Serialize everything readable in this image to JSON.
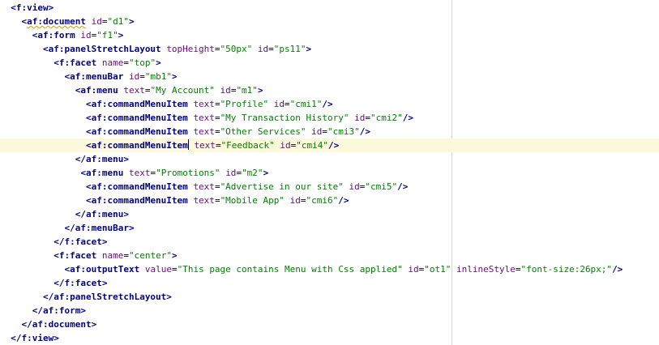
{
  "editor": {
    "language": "jspx",
    "current_line": 10,
    "lines": [
      {
        "indent": "  ",
        "segments": [
          [
            "tag",
            "<f:view>"
          ]
        ]
      },
      {
        "indent": "    ",
        "segments": [
          [
            "tag",
            "<af:document"
          ],
          [
            "plain",
            " "
          ],
          [
            "attr",
            "id"
          ],
          [
            "plain",
            "="
          ],
          [
            "val",
            "\"d1\""
          ],
          [
            "tag",
            ">"
          ]
        ],
        "squiggle_on": "af:document"
      },
      {
        "indent": "      ",
        "segments": [
          [
            "tag",
            "<af:form"
          ],
          [
            "plain",
            " "
          ],
          [
            "attr",
            "id"
          ],
          [
            "plain",
            "="
          ],
          [
            "val",
            "\"f1\""
          ],
          [
            "tag",
            ">"
          ]
        ]
      },
      {
        "indent": "        ",
        "segments": [
          [
            "tag",
            "<af:panelStretchLayout"
          ],
          [
            "plain",
            " "
          ],
          [
            "attr",
            "topHeight"
          ],
          [
            "plain",
            "="
          ],
          [
            "val",
            "\"50px\""
          ],
          [
            "plain",
            " "
          ],
          [
            "attr",
            "id"
          ],
          [
            "plain",
            "="
          ],
          [
            "val",
            "\"ps11\""
          ],
          [
            "tag",
            ">"
          ]
        ]
      },
      {
        "indent": "          ",
        "segments": [
          [
            "tag",
            "<f:facet"
          ],
          [
            "plain",
            " "
          ],
          [
            "attr",
            "name"
          ],
          [
            "plain",
            "="
          ],
          [
            "val",
            "\"top\""
          ],
          [
            "tag",
            ">"
          ]
        ]
      },
      {
        "indent": "            ",
        "segments": [
          [
            "tag",
            "<af:menuBar"
          ],
          [
            "plain",
            " "
          ],
          [
            "attr",
            "id"
          ],
          [
            "plain",
            "="
          ],
          [
            "val",
            "\"mb1\""
          ],
          [
            "tag",
            ">"
          ]
        ]
      },
      {
        "indent": "              ",
        "segments": [
          [
            "tag",
            "<af:menu"
          ],
          [
            "plain",
            " "
          ],
          [
            "attr",
            "text"
          ],
          [
            "plain",
            "="
          ],
          [
            "val",
            "\"My Account\""
          ],
          [
            "plain",
            " "
          ],
          [
            "attr",
            "id"
          ],
          [
            "plain",
            "="
          ],
          [
            "val",
            "\"m1\""
          ],
          [
            "tag",
            ">"
          ]
        ]
      },
      {
        "indent": "                ",
        "segments": [
          [
            "tag",
            "<af:commandMenuItem"
          ],
          [
            "plain",
            " "
          ],
          [
            "attr",
            "text"
          ],
          [
            "plain",
            "="
          ],
          [
            "val",
            "\"Profile\""
          ],
          [
            "plain",
            " "
          ],
          [
            "attr",
            "id"
          ],
          [
            "plain",
            "="
          ],
          [
            "val",
            "\"cmi1\""
          ],
          [
            "tag",
            "/>"
          ]
        ]
      },
      {
        "indent": "                ",
        "segments": [
          [
            "tag",
            "<af:commandMenuItem"
          ],
          [
            "plain",
            " "
          ],
          [
            "attr",
            "text"
          ],
          [
            "plain",
            "="
          ],
          [
            "val",
            "\"My Transaction History\""
          ],
          [
            "plain",
            " "
          ],
          [
            "attr",
            "id"
          ],
          [
            "plain",
            "="
          ],
          [
            "val",
            "\"cmi2\""
          ],
          [
            "tag",
            "/>"
          ]
        ]
      },
      {
        "indent": "                ",
        "segments": [
          [
            "tag",
            "<af:commandMenuItem"
          ],
          [
            "plain",
            " "
          ],
          [
            "attr",
            "text"
          ],
          [
            "plain",
            "="
          ],
          [
            "val",
            "\"Other Services\""
          ],
          [
            "plain",
            " "
          ],
          [
            "attr",
            "id"
          ],
          [
            "plain",
            "="
          ],
          [
            "val",
            "\"cmi3\""
          ],
          [
            "tag",
            "/>"
          ]
        ]
      },
      {
        "indent": "                ",
        "segments": [
          [
            "tag",
            "<af:commandMenuItem"
          ],
          [
            "caret",
            ""
          ],
          [
            "plain",
            " "
          ],
          [
            "attr",
            "text"
          ],
          [
            "plain",
            "="
          ],
          [
            "val",
            "\"Feedback\""
          ],
          [
            "plain",
            " "
          ],
          [
            "attr",
            "id"
          ],
          [
            "plain",
            "="
          ],
          [
            "val",
            "\"cmi4\""
          ],
          [
            "tag",
            "/>"
          ]
        ]
      },
      {
        "indent": "              ",
        "segments": [
          [
            "tag",
            "</af:menu>"
          ]
        ]
      },
      {
        "indent": "               ",
        "segments": [
          [
            "tag",
            "<af:menu"
          ],
          [
            "plain",
            " "
          ],
          [
            "attr",
            "text"
          ],
          [
            "plain",
            "="
          ],
          [
            "val",
            "\"Promotions\""
          ],
          [
            "plain",
            " "
          ],
          [
            "attr",
            "id"
          ],
          [
            "plain",
            "="
          ],
          [
            "val",
            "\"m2\""
          ],
          [
            "tag",
            ">"
          ]
        ]
      },
      {
        "indent": "                ",
        "segments": [
          [
            "tag",
            "<af:commandMenuItem"
          ],
          [
            "plain",
            " "
          ],
          [
            "attr",
            "text"
          ],
          [
            "plain",
            "="
          ],
          [
            "val",
            "\"Advertise in our site\""
          ],
          [
            "plain",
            " "
          ],
          [
            "attr",
            "id"
          ],
          [
            "plain",
            "="
          ],
          [
            "val",
            "\"cmi5\""
          ],
          [
            "tag",
            "/>"
          ]
        ]
      },
      {
        "indent": "                ",
        "segments": [
          [
            "tag",
            "<af:commandMenuItem"
          ],
          [
            "plain",
            " "
          ],
          [
            "attr",
            "text"
          ],
          [
            "plain",
            "="
          ],
          [
            "val",
            "\"Mobile App\""
          ],
          [
            "plain",
            " "
          ],
          [
            "attr",
            "id"
          ],
          [
            "plain",
            "="
          ],
          [
            "val",
            "\"cmi6\""
          ],
          [
            "tag",
            "/>"
          ]
        ]
      },
      {
        "indent": "              ",
        "segments": [
          [
            "tag",
            "</af:menu>"
          ]
        ]
      },
      {
        "indent": "            ",
        "segments": [
          [
            "tag",
            "</af:menuBar>"
          ]
        ]
      },
      {
        "indent": "          ",
        "segments": [
          [
            "tag",
            "</f:facet>"
          ]
        ]
      },
      {
        "indent": "          ",
        "segments": [
          [
            "tag",
            "<f:facet"
          ],
          [
            "plain",
            " "
          ],
          [
            "attr",
            "name"
          ],
          [
            "plain",
            "="
          ],
          [
            "val",
            "\"center\""
          ],
          [
            "tag",
            ">"
          ]
        ]
      },
      {
        "indent": "            ",
        "segments": [
          [
            "tag",
            "<af:outputText"
          ],
          [
            "plain",
            " "
          ],
          [
            "attr",
            "value"
          ],
          [
            "plain",
            "="
          ],
          [
            "val",
            "\"This page contains Menu with Css applied\""
          ],
          [
            "plain",
            " "
          ],
          [
            "attr",
            "id"
          ],
          [
            "plain",
            "="
          ],
          [
            "val",
            "\"ot1\""
          ],
          [
            "plain",
            " "
          ],
          [
            "attr",
            "inlineStyle"
          ],
          [
            "plain",
            "="
          ],
          [
            "val",
            "\"font-size:26px;\""
          ],
          [
            "tag",
            "/>"
          ]
        ]
      },
      {
        "indent": "          ",
        "segments": [
          [
            "tag",
            "</f:facet>"
          ]
        ]
      },
      {
        "indent": "        ",
        "segments": [
          [
            "tag",
            "</af:panelStretchLayout>"
          ]
        ]
      },
      {
        "indent": "      ",
        "segments": [
          [
            "tag",
            "</af:form>"
          ]
        ]
      },
      {
        "indent": "    ",
        "segments": [
          [
            "tag",
            "</af:document>"
          ]
        ]
      },
      {
        "indent": "  ",
        "segments": [
          [
            "tag",
            "</f:view>"
          ]
        ]
      }
    ]
  }
}
